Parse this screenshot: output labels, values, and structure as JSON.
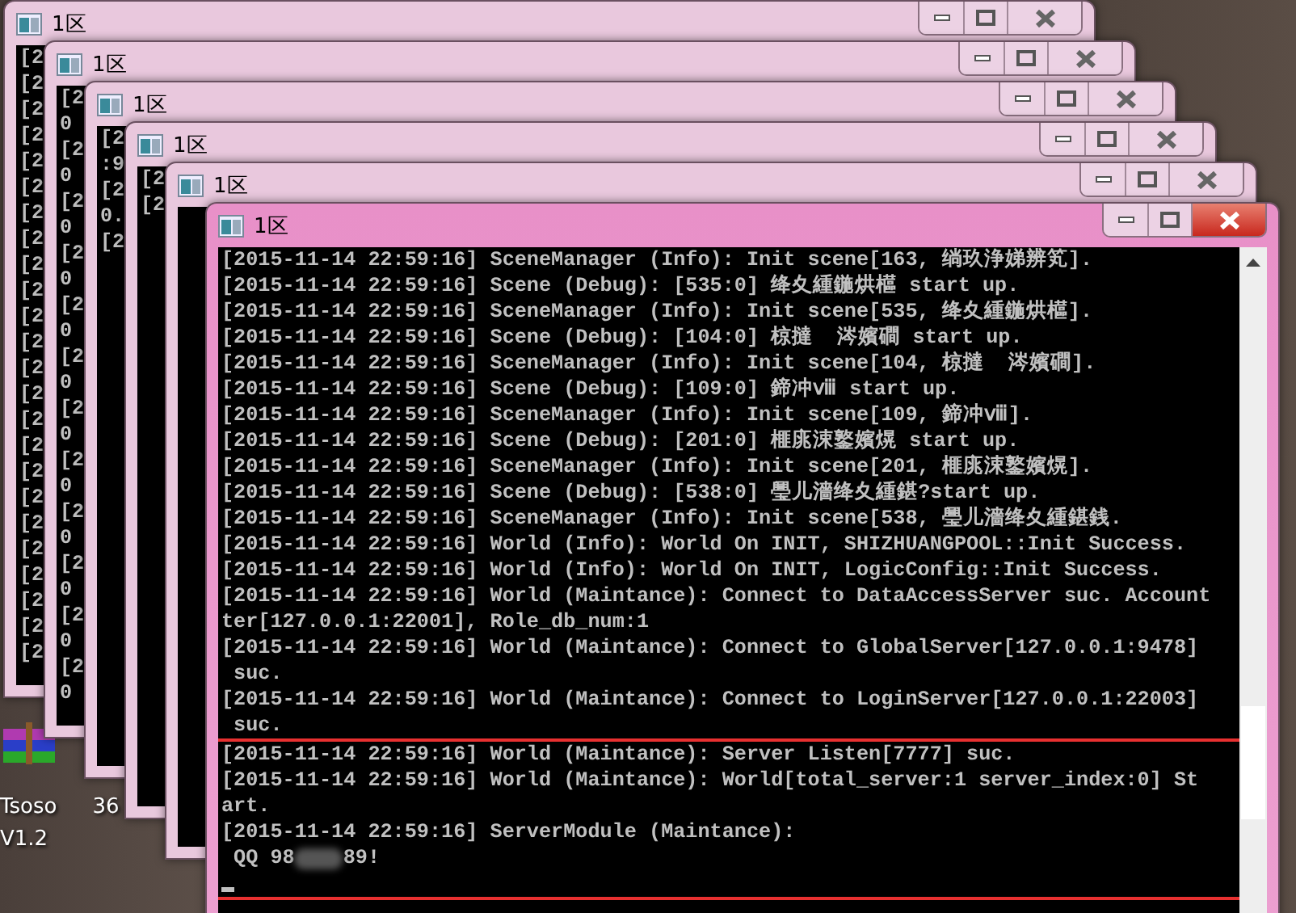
{
  "desktop_icons": [
    {
      "label": "Tsoso\nV1.2"
    },
    {
      "label": "36"
    }
  ],
  "windows": [
    {
      "title": "1区",
      "active": false,
      "lines": [
        "[2",
        "[2",
        "[2",
        "[2",
        "[2",
        "[2",
        "[2",
        "[2",
        "[2",
        "[2",
        "[2",
        "[2",
        "[2",
        "[2",
        "[2",
        "[2",
        "[2",
        "[2",
        "[2",
        "[2",
        "[2",
        "[2",
        "[2",
        "[2"
      ]
    },
    {
      "title": "1区",
      "active": false,
      "lines": [
        "[2",
        "0",
        "[2",
        "0",
        "[2",
        "0",
        "[2",
        "0",
        "[2",
        "0",
        "[2",
        "0",
        "[2",
        "0",
        "[2",
        "0",
        "[2",
        "0",
        "[2",
        "0",
        "[2",
        "0",
        "[2",
        "0"
      ]
    },
    {
      "title": "1区",
      "active": false,
      "lines": [
        "[2",
        ":9",
        "[2",
        "0.",
        "[2"
      ]
    },
    {
      "title": "1区",
      "active": false,
      "lines": [
        "[2",
        "[2"
      ]
    },
    {
      "title": "1区",
      "active": false
    },
    {
      "title": "1区",
      "active": true,
      "lines": [
        {
          "text": "[2015-11-14 22:59:16] SceneManager (Info): Init scene[163, 绱玖浄娣辨笂].",
          "highlighted": false
        },
        {
          "text": "[2015-11-14 22:59:16] Scene (Debug): [535:0] 绛夊緟鍦烘櫙 start up.",
          "highlighted": false
        },
        {
          "text": "[2015-11-14 22:59:16] SceneManager (Info): Init scene[535, 绛夊緟鍦烘櫙].",
          "highlighted": false
        },
        {
          "text": "[2015-11-14 22:59:16] Scene (Debug): [104:0] 椋撻  涔嬪磵 start up.",
          "highlighted": false
        },
        {
          "text": "[2015-11-14 22:59:16] SceneManager (Info): Init scene[104, 椋撻  涔嬪磵].",
          "highlighted": false
        },
        {
          "text": "[2015-11-14 22:59:16] Scene (Debug): [109:0] 鍗冲ⅷ start up.",
          "highlighted": false
        },
        {
          "text": "[2015-11-14 22:59:16] SceneManager (Info): Init scene[109, 鍗冲ⅷ].",
          "highlighted": false
        },
        {
          "text": "[2015-11-14 22:59:16] Scene (Debug): [201:0] 榧庣涑鐜嬪熀 start up.",
          "highlighted": false
        },
        {
          "text": "[2015-11-14 22:59:16] SceneManager (Info): Init scene[201, 榧庣涑鐜嬪熀].",
          "highlighted": false
        },
        {
          "text": "[2015-11-14 22:59:16] Scene (Debug): [538:0] 璺儿濇绛夊緟鍖?start up.",
          "highlighted": false
        },
        {
          "text": "[2015-11-14 22:59:16] SceneManager (Info): Init scene[538, 璺儿濇绛夊緟鍖銭.",
          "highlighted": false
        },
        {
          "text": "[2015-11-14 22:59:16] World (Info): World On INIT, SHIZHUANGPOOL::Init Success.",
          "highlighted": false
        },
        {
          "text": "[2015-11-14 22:59:16] World (Info): World On INIT, LogicConfig::Init Success.",
          "highlighted": false
        },
        {
          "text": "[2015-11-14 22:59:16] World (Maintance): Connect to DataAccessServer suc. Account",
          "highlighted": false
        },
        {
          "text": "ter[127.0.0.1:22001], Role_db_num:1",
          "highlighted": false
        },
        {
          "text": "[2015-11-14 22:59:16] World (Maintance): Connect to GlobalServer[127.0.0.1:9478]",
          "highlighted": false
        },
        {
          "text": " suc.",
          "highlighted": false
        },
        {
          "text": "[2015-11-14 22:59:16] World (Maintance): Connect to LoginServer[127.0.0.1:22003]",
          "highlighted": false
        },
        {
          "text": " suc.",
          "highlighted": false
        },
        {
          "text": "[2015-11-14 22:59:16] World (Maintance): Server Listen[7777] suc.",
          "highlighted": true
        },
        {
          "text": "[2015-11-14 22:59:16] World (Maintance): World[total_server:1 server_index:0] St",
          "highlighted": true
        },
        {
          "text": "art.",
          "highlighted": true
        },
        {
          "text": "[2015-11-14 22:59:16] ServerModule (Maintance):",
          "highlighted": true
        },
        {
          "text": " QQ 98",
          "redacted_after": "89!",
          "highlighted": true
        }
      ]
    }
  ]
}
